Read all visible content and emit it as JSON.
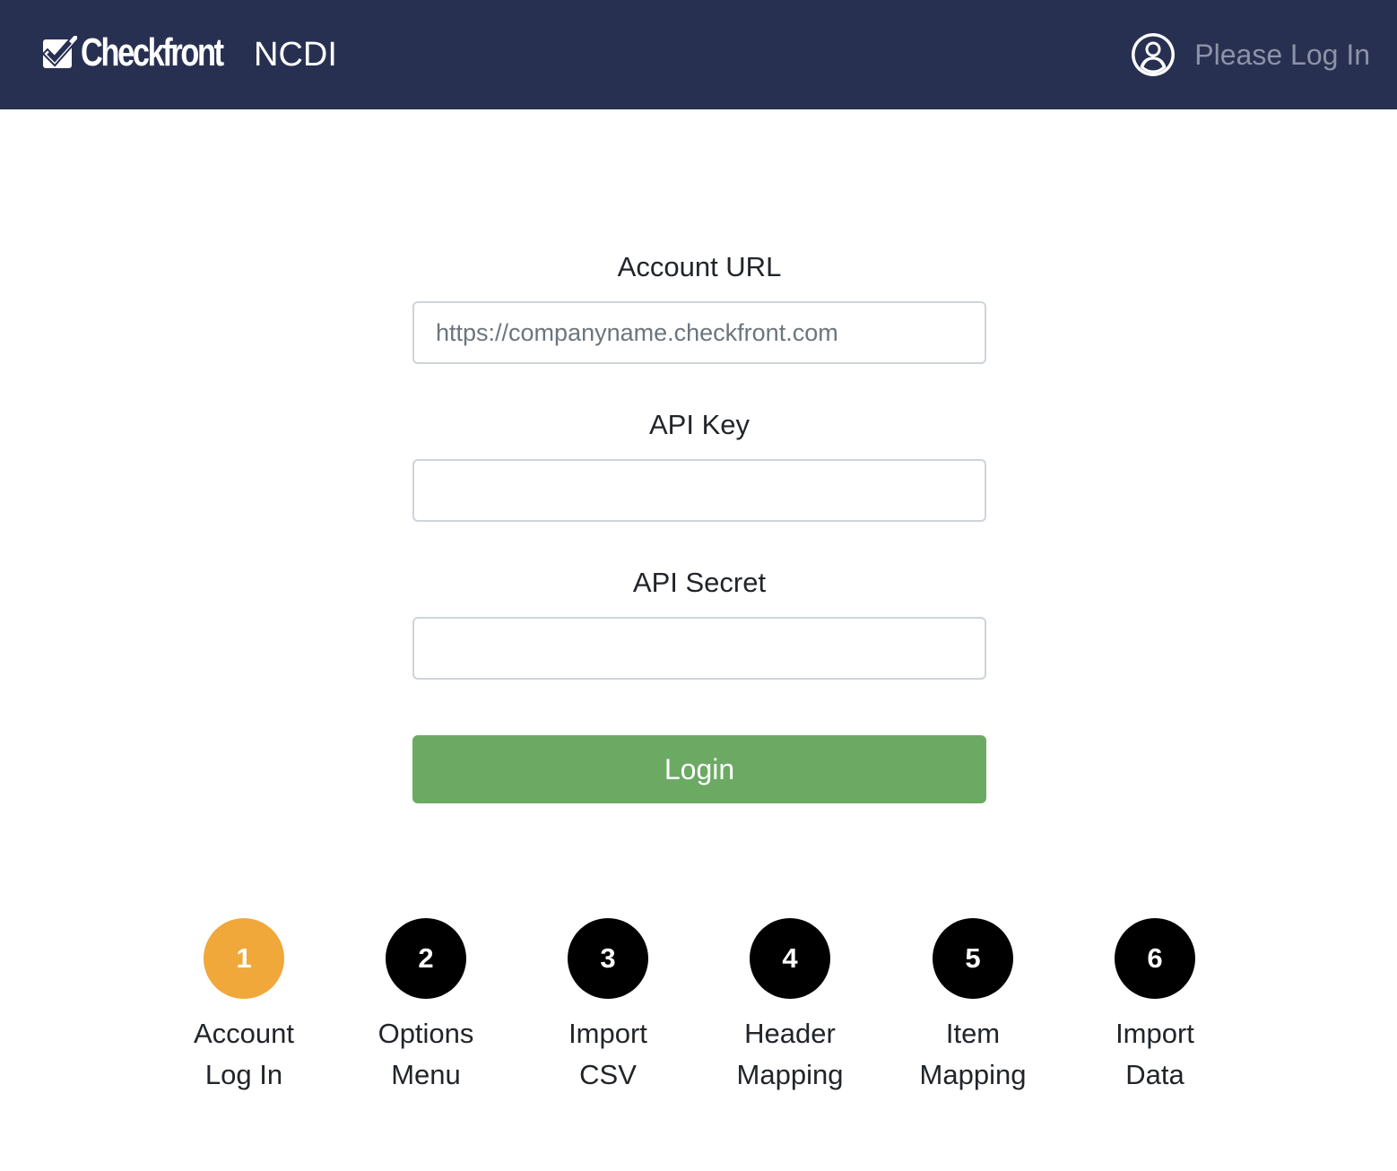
{
  "navbar": {
    "brand_name": "Checkfront",
    "brand_subtitle": "NCDI",
    "brand_icon": "checkbox-icon",
    "user_icon": "user-circle-icon",
    "user_label": "Please Log In",
    "background_color": "#283052"
  },
  "form": {
    "account_url": {
      "label": "Account URL",
      "placeholder": "https://companyname.checkfront.com",
      "value": ""
    },
    "api_key": {
      "label": "API Key",
      "placeholder": "",
      "value": ""
    },
    "api_secret": {
      "label": "API Secret",
      "placeholder": "",
      "value": ""
    },
    "login_label": "Login",
    "login_color": "#6caa64"
  },
  "steps": {
    "active_step": 1,
    "active_color": "#f0a83b",
    "items": [
      {
        "number": "1",
        "line1": "Account",
        "line2": "Log In"
      },
      {
        "number": "2",
        "line1": "Options",
        "line2": "Menu"
      },
      {
        "number": "3",
        "line1": "Import",
        "line2": "CSV"
      },
      {
        "number": "4",
        "line1": "Header",
        "line2": "Mapping"
      },
      {
        "number": "5",
        "line1": "Item",
        "line2": "Mapping"
      },
      {
        "number": "6",
        "line1": "Import",
        "line2": "Data"
      }
    ]
  }
}
